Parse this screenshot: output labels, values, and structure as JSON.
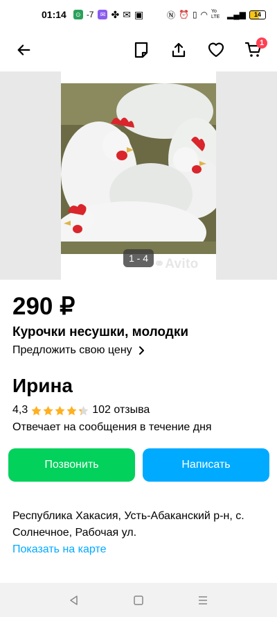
{
  "status_bar": {
    "time": "01:14",
    "temp": "-7",
    "battery": "14",
    "network": "Yo LTE"
  },
  "app_bar": {
    "cart_count": "1"
  },
  "gallery": {
    "counter": "1 - 4",
    "watermark": "Avito"
  },
  "listing": {
    "price": "290 ₽",
    "title": "Курочки несушки, молодки",
    "offer_price": "Предложить свою цену"
  },
  "seller": {
    "name": "Ирина",
    "rating": "4,3",
    "rating_stars": 4.3,
    "reviews": "102 отзыва",
    "reply_time": "Отвечает на сообщения в течение дня"
  },
  "actions": {
    "call": "Позвонить",
    "write": "Написать"
  },
  "location": {
    "address": "Республика Хакасия, Усть-Абаканский р-н, с. Солнечное, Рабочая ул.",
    "map_link": "Показать на карте"
  },
  "colors": {
    "call_button": "#02d15c",
    "write_button": "#00aaff",
    "link": "#00aaff",
    "star": "#ffb021",
    "badge": "#ff4053"
  }
}
